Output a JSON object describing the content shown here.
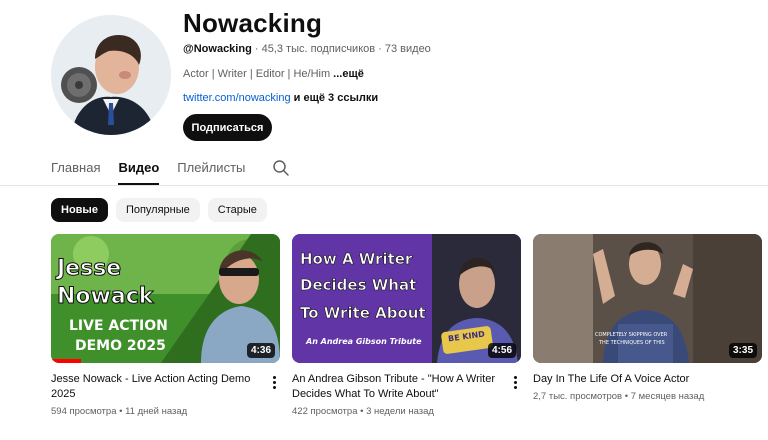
{
  "channel": {
    "name": "Nowacking",
    "handle": "@Nowacking",
    "meta_rest": " · 45,3 тыс. подписчиков · 73 видео",
    "description": "Actor | Writer | Editor | He/Him",
    "description_more": " ...ещё",
    "link": "twitter.com/nowacking",
    "more_links": " и ещё 3 ссылки",
    "subscribe_label": "Подписаться"
  },
  "tabs": [
    {
      "label": "Главная"
    },
    {
      "label": "Видео"
    },
    {
      "label": "Плейлисты"
    }
  ],
  "chips": [
    {
      "label": "Новые"
    },
    {
      "label": "Популярные"
    },
    {
      "label": "Старые"
    }
  ],
  "videos": [
    {
      "title": "Jesse Nowack - Live Action Acting Demo 2025",
      "views": "594 просмотра",
      "age": "11 дней назад",
      "duration": "4:36",
      "thumb_lines": [
        "Jesse",
        "Nowack",
        "LIVE ACTION",
        "DEMO 2025"
      ]
    },
    {
      "title": "An Andrea Gibson Tribute - \"How A Writer Decides What To Write About\"",
      "views": "422 просмотра",
      "age": "3 недели назад",
      "duration": "4:56",
      "thumb_lines": [
        "How A Writer",
        "Decides What",
        "To Write About",
        "An Andrea Gibson Tribute",
        "BE KIND"
      ]
    },
    {
      "title": "Day In The Life Of A Voice Actor",
      "views": "2,7 тыс. просмотров",
      "age": "7 месяцев назад",
      "duration": "3:35",
      "thumb_lines": [
        "COMPLETELY SKIPPING OVER",
        "THE TECHNIQUES OF THIS"
      ]
    }
  ],
  "icons": {
    "search": "search-icon",
    "more": "more-vert-icon"
  }
}
